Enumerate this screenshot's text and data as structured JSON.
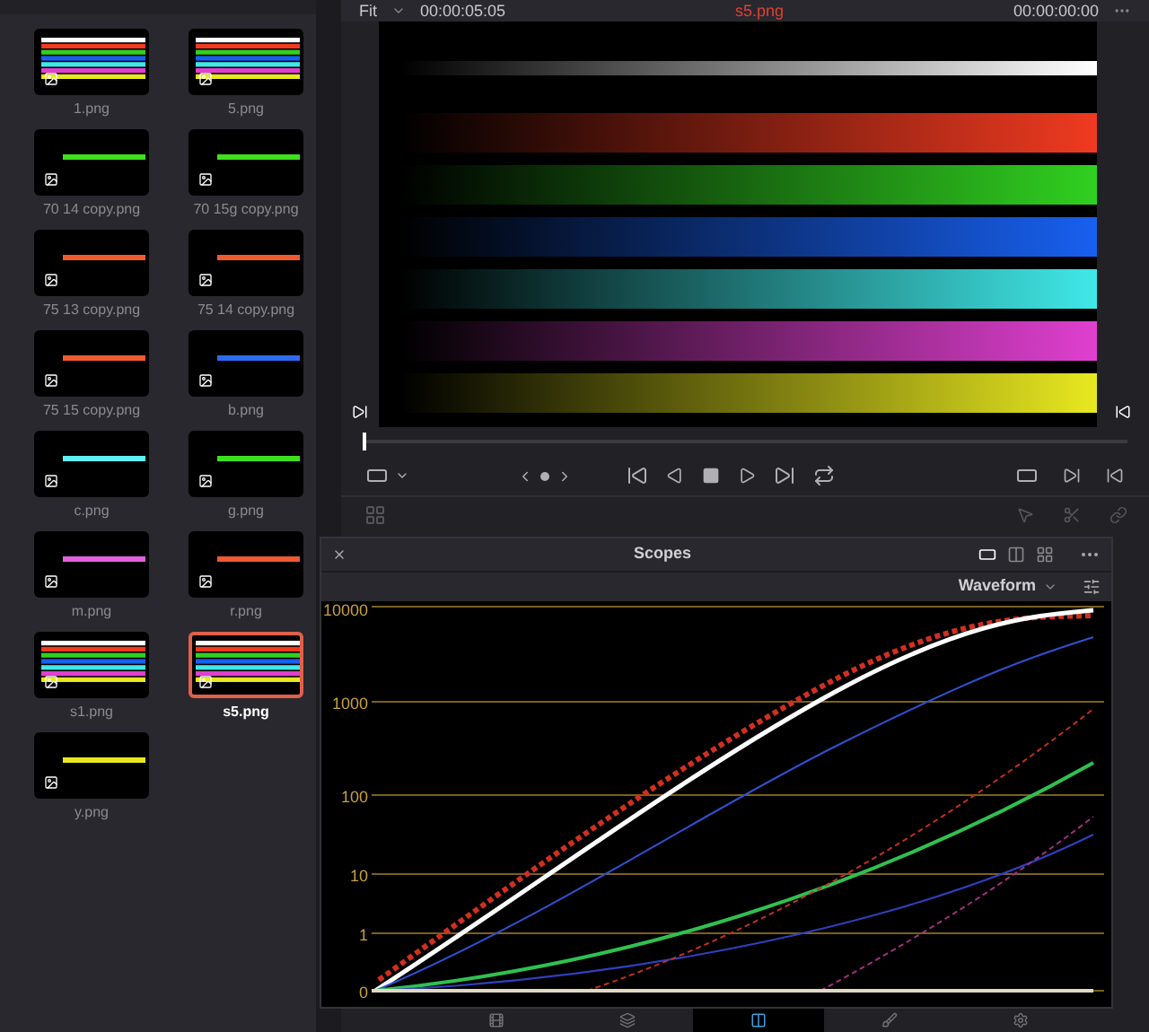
{
  "media_pool": {
    "clips": [
      {
        "name": "1.png",
        "kind": "bars",
        "selected": false
      },
      {
        "name": "5.png",
        "kind": "bars",
        "selected": false
      },
      {
        "name": "70 14 copy.png",
        "kind": "line",
        "color": "#3ee01e",
        "selected": false
      },
      {
        "name": "70 15g copy.png",
        "kind": "line",
        "color": "#3ee01e",
        "selected": false
      },
      {
        "name": "75 13 copy.png",
        "kind": "line",
        "color": "#f05a30",
        "selected": false
      },
      {
        "name": "75 14 copy.png",
        "kind": "line",
        "color": "#f05a30",
        "selected": false
      },
      {
        "name": "75 15 copy.png",
        "kind": "line",
        "color": "#f05a30",
        "selected": false
      },
      {
        "name": "b.png",
        "kind": "line",
        "color": "#2d6cf0",
        "selected": false
      },
      {
        "name": "c.png",
        "kind": "line",
        "color": "#5ef0f0",
        "selected": false
      },
      {
        "name": "g.png",
        "kind": "line",
        "color": "#3ee01e",
        "selected": false
      },
      {
        "name": "m.png",
        "kind": "line",
        "color": "#e060e0",
        "selected": false
      },
      {
        "name": "r.png",
        "kind": "line",
        "color": "#f05a30",
        "selected": false
      },
      {
        "name": "s1.png",
        "kind": "bars",
        "selected": false
      },
      {
        "name": "s5.png",
        "kind": "bars",
        "selected": true
      },
      {
        "name": "y.png",
        "kind": "line",
        "color": "#e8e820",
        "selected": false
      }
    ]
  },
  "viewer": {
    "zoom": "Fit",
    "duration": "00:00:05:05",
    "clip_name": "s5.png",
    "timecode": "00:00:00:00",
    "scrubber": {
      "level": 0
    }
  },
  "scopes": {
    "title": "Scopes",
    "mode": "Waveform",
    "scale_labels": [
      "10000",
      "1000",
      "100",
      "10",
      "1",
      "0"
    ]
  },
  "page_tabs": [
    {
      "selected": false
    },
    {
      "selected": false
    },
    {
      "selected": true
    },
    {
      "selected": false
    },
    {
      "selected": false
    }
  ]
}
